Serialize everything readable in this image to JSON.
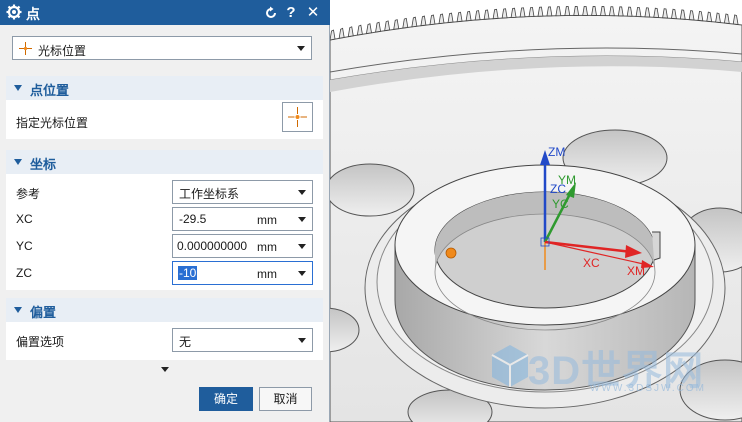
{
  "dialog": {
    "title": "点",
    "title_buttons": {
      "reset_icon": "reset-icon",
      "help_label": "?",
      "close_label": "✕"
    },
    "type_selector": {
      "value": "光标位置",
      "icon": "cursor-point-icon"
    },
    "point_location": {
      "header": "点位置",
      "specify_label": "指定光标位置",
      "pick_icon": "cursor-point-icon"
    },
    "coordinates": {
      "header": "坐标",
      "reference_label": "参考",
      "reference_value": "工作坐标系",
      "xc_label": "XC",
      "xc_value": "-29.5",
      "yc_label": "YC",
      "yc_value": "0.000000000",
      "zc_label": "ZC",
      "zc_value": "-10",
      "unit": "mm"
    },
    "offset": {
      "header": "偏置",
      "option_label": "偏置选项",
      "option_value": "无"
    },
    "ok_label": "确定",
    "cancel_label": "取消"
  },
  "viewport": {
    "axes": {
      "zm": "ZM",
      "zc": "ZC",
      "ym": "YM",
      "yc": "YC",
      "xc": "XC",
      "xm": "XM"
    },
    "watermark": {
      "text": "3D世界网",
      "sub": "WWW.3DSJW.COM"
    }
  },
  "colors": {
    "title_bar": "#1f5d9c",
    "section_header_text": "#1f5d9c",
    "selection": "#2a6fd3",
    "axis_z": "#2149c8",
    "axis_y": "#2f9a2f",
    "axis_x": "#e02525",
    "point_marker": "#f08a1c"
  }
}
